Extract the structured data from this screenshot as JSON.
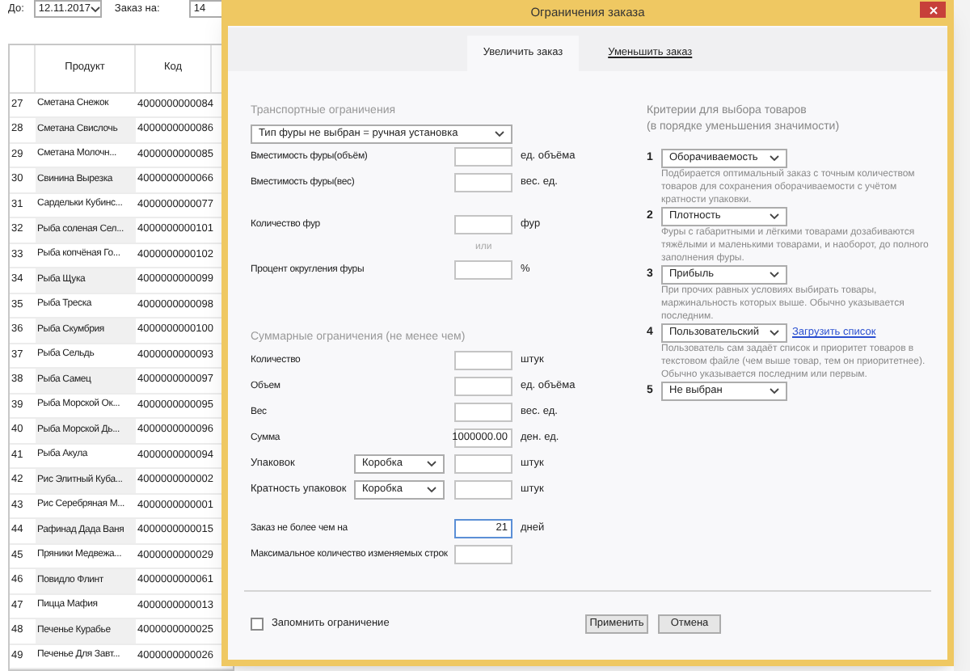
{
  "filter_bar": {
    "date_label": "До:",
    "date_value": "12.11.2017",
    "order_label": "Заказ на:",
    "order_value": "14"
  },
  "table": {
    "columns": [
      "Продукт",
      "Код"
    ],
    "rows": [
      {
        "number": "27",
        "product": "Сметана Снежок",
        "code": "4000000000084"
      },
      {
        "number": "28",
        "product": "Сметана Свислочь",
        "code": "4000000000086"
      },
      {
        "number": "29",
        "product": "Сметана Молочн...",
        "code": "4000000000085"
      },
      {
        "number": "30",
        "product": "Свинина Вырезка",
        "code": "4000000000066"
      },
      {
        "number": "31",
        "product": "Сардельки Кубинс...",
        "code": "4000000000077"
      },
      {
        "number": "32",
        "product": "Рыба соленая Сел...",
        "code": "4000000000101"
      },
      {
        "number": "33",
        "product": "Рыба копчёная Го...",
        "code": "4000000000102"
      },
      {
        "number": "34",
        "product": "Рыба Щука",
        "code": "4000000000099"
      },
      {
        "number": "35",
        "product": "Рыба Треска",
        "code": "4000000000098"
      },
      {
        "number": "36",
        "product": "Рыба Скумбрия",
        "code": "4000000000100"
      },
      {
        "number": "37",
        "product": "Рыба Сельдь",
        "code": "4000000000093"
      },
      {
        "number": "38",
        "product": "Рыба Самец",
        "code": "4000000000097"
      },
      {
        "number": "39",
        "product": "Рыба Морской Ок...",
        "code": "4000000000095"
      },
      {
        "number": "40",
        "product": "Рыба Морской Дь...",
        "code": "4000000000096"
      },
      {
        "number": "41",
        "product": "Рыба Акула",
        "code": "4000000000094"
      },
      {
        "number": "42",
        "product": "Рис Элитный Куба...",
        "code": "4000000000002"
      },
      {
        "number": "43",
        "product": "Рис Серебряная М...",
        "code": "4000000000001"
      },
      {
        "number": "44",
        "product": "Рафинад Дада Ваня",
        "code": "4000000000015"
      },
      {
        "number": "45",
        "product": "Пряники Медвежа...",
        "code": "4000000000029"
      },
      {
        "number": "46",
        "product": "Повидло Флинт",
        "code": "4000000000061"
      },
      {
        "number": "47",
        "product": "Пицца Мафия",
        "code": "4000000000013"
      },
      {
        "number": "48",
        "product": "Печенье Курабье",
        "code": "4000000000025"
      },
      {
        "number": "49",
        "product": "Печенье Для Завт...",
        "code": "4000000000026"
      }
    ]
  },
  "dialog": {
    "title": "Ограничения заказа",
    "tabs": [
      {
        "label": "Увеличить заказ",
        "selected": true
      },
      {
        "label": "Уменьшить заказ",
        "selected": false
      }
    ],
    "transport": {
      "title": "Транспортные ограничения",
      "truck_type": "Тип фуры не выбран = ручная установка",
      "rows": [
        {
          "kind": "field",
          "label": "Вместимость фуры(объём)",
          "unit": "ед. объёма"
        },
        {
          "kind": "field",
          "label": "Вместимость фуры(вес)",
          "unit": "вес. ед."
        },
        {
          "kind": "field",
          "label": "Количество фур",
          "unit": "фур"
        },
        {
          "kind": "or",
          "label": "или"
        },
        {
          "kind": "field",
          "label": "Процент округления фуры",
          "unit": "%"
        }
      ]
    },
    "summary": {
      "title": "Суммарные ограничения (не менее чем)",
      "rows": [
        {
          "label": "Количество",
          "unit": "штук"
        },
        {
          "label": "Объем",
          "unit": "ед. объёма"
        },
        {
          "label": "Вес",
          "unit": "вес. ед."
        },
        {
          "label": "Сумма",
          "value": "1000000.00",
          "unit": "ден. ед."
        },
        {
          "label": "Упаковок",
          "select": "Коробка",
          "unit": "штук"
        },
        {
          "label": "Кратность упаковок",
          "select": "Коробка",
          "unit": "штук"
        }
      ]
    },
    "limits": [
      {
        "label": "Заказ не более чем на",
        "value": "21",
        "unit": "дней",
        "focused": true
      },
      {
        "label": "Максимальное количество изменяемых строк",
        "focused": false
      }
    ],
    "criteria": {
      "title": "Критерии для выбора товаров",
      "subtitle": "(в порядке уменьшения значимости)",
      "items": [
        {
          "number": "1",
          "value": "Оборачиваемость",
          "description": "Подбирается оптимальный заказ с точным количеством товаров для сохранения оборачиваемости с учётом кратности упаковки."
        },
        {
          "number": "2",
          "value": "Плотность",
          "description": "Фуры с габаритными и лёгкими товарами дозабиваются тяжёлыми и маленькими товарами, и наоборот, до полного заполнения фуры."
        },
        {
          "number": "3",
          "value": "Прибыль",
          "description": "При прочих равных условиях выбирать товары, маржинальность которых выше. Обычно указывается последним."
        },
        {
          "number": "4",
          "value": "Пользовательский",
          "link": "Загрузить список",
          "description": "Пользователь сам задаёт список и приоритет товаров в текстовом файле (чем выше товар, тем он приоритетнее). Обычно указывается последним или первым."
        },
        {
          "number": "5",
          "value": "Не выбран"
        }
      ]
    },
    "remember": {
      "label": "Запомнить ограничение",
      "checked": false
    },
    "buttons": [
      "Применить",
      "Отмена"
    ]
  }
}
